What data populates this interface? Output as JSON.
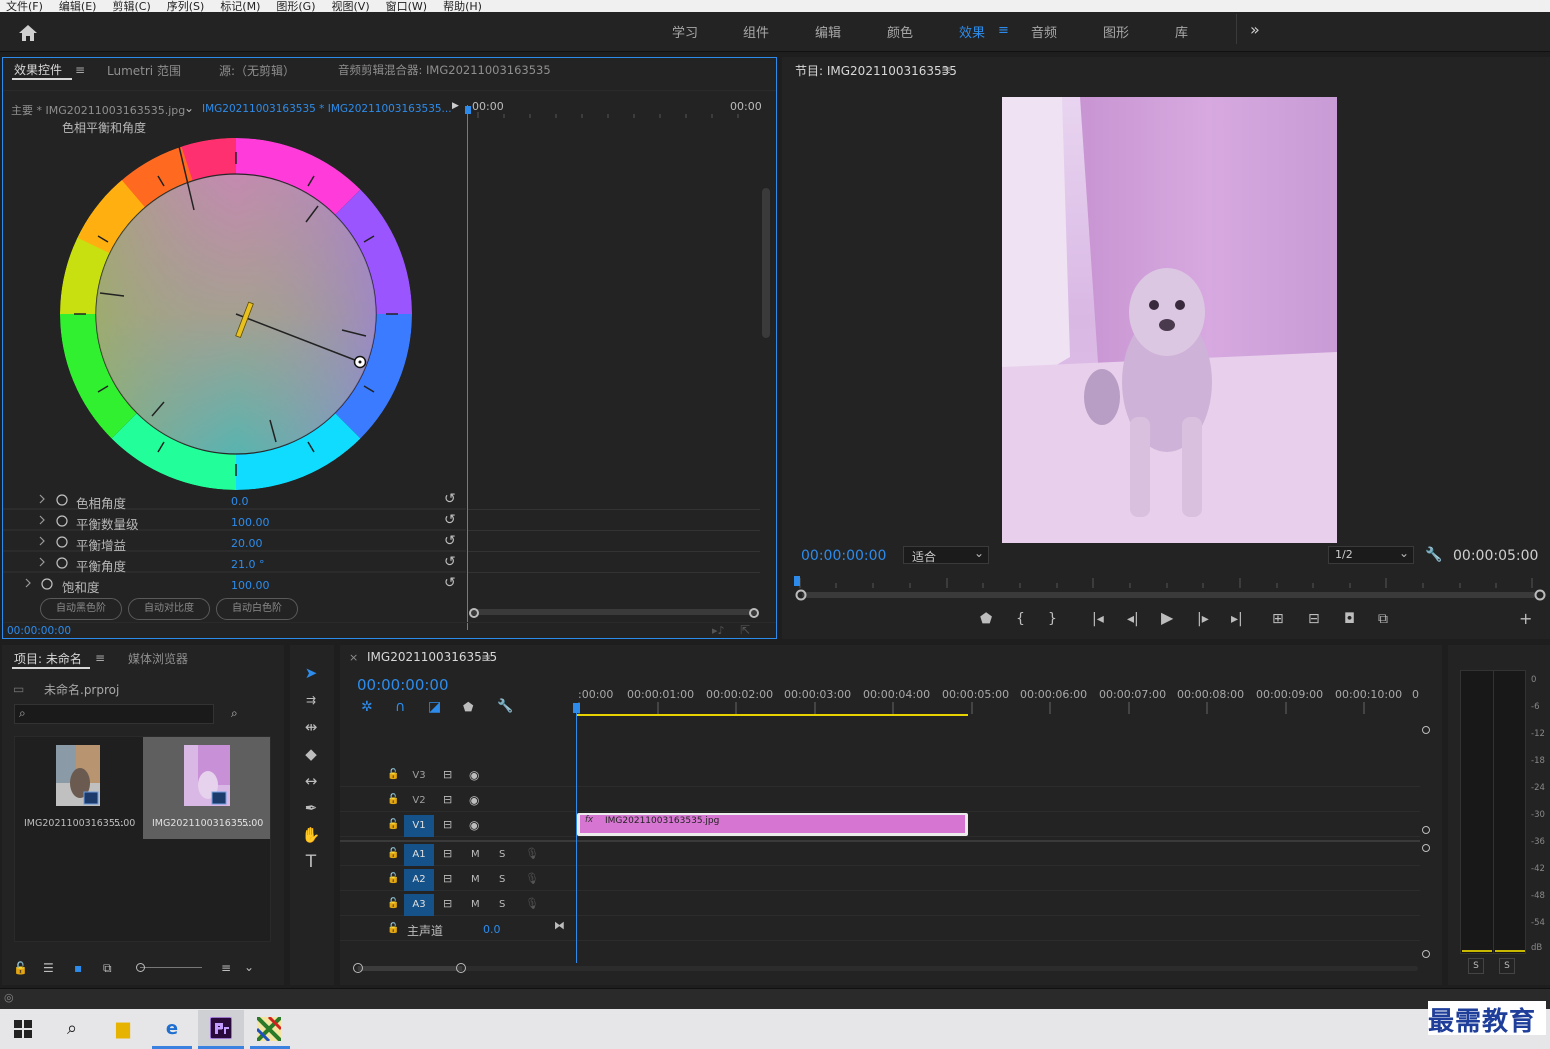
{
  "menu": [
    "文件(F)",
    "编辑(E)",
    "剪辑(C)",
    "序列(S)",
    "标记(M)",
    "图形(G)",
    "视图(V)",
    "窗口(W)",
    "帮助(H)"
  ],
  "workspaces": [
    "学习",
    "组件",
    "编辑",
    "颜色",
    "效果",
    "音频",
    "图形",
    "库"
  ],
  "workspace_active": "效果",
  "effect_panel": {
    "tabs": [
      "效果控件",
      "Lumetri 范围",
      "源:（无剪辑）",
      "音频剪辑混合器: IMG20211003163535"
    ],
    "master_clip": "主要 * IMG20211003163535.jpg",
    "sequence_clip": "IMG20211003163535 * IMG20211003163535...",
    "ruler_start": "00:00",
    "ruler_end": "00:00",
    "section_title": "色相平衡和角度",
    "properties": [
      {
        "label": "色相角度",
        "value": "0.0"
      },
      {
        "label": "平衡数量级",
        "value": "100.00"
      },
      {
        "label": "平衡增益",
        "value": "20.00"
      },
      {
        "label": "平衡角度",
        "value": "21.0 °"
      },
      {
        "label": "饱和度",
        "value": "100.00"
      }
    ],
    "buttons": [
      "自动黑色阶",
      "自动对比度",
      "自动白色阶"
    ],
    "timecode": "00:00:00:00"
  },
  "program_monitor": {
    "title": "节目: IMG20211003163535",
    "timecode": "00:00:00:00",
    "fit": "适合",
    "resolution": "1/2",
    "duration": "00:00:05:00"
  },
  "project": {
    "tabs": [
      "项目: 未命名",
      "媒体浏览器"
    ],
    "file": "未命名.prproj",
    "items": [
      {
        "name": "IMG202110031635...",
        "duration": "5:00"
      },
      {
        "name": "IMG202110031635...",
        "duration": "5:00"
      }
    ]
  },
  "timeline": {
    "tab": "IMG20211003163535",
    "timecode": "00:00:00:00",
    "ruler": [
      ":00:00",
      "00:00:01:00",
      "00:00:02:00",
      "00:00:03:00",
      "00:00:04:00",
      "00:00:05:00",
      "00:00:06:00",
      "00:00:07:00",
      "00:00:08:00",
      "00:00:09:00",
      "00:00:10:00",
      "0"
    ],
    "video_tracks": [
      "V3",
      "V2",
      "V1"
    ],
    "audio_tracks": [
      "A1",
      "A2",
      "A3"
    ],
    "master": "主声道",
    "master_value": "0.0",
    "clip": "IMG20211003163535.jpg",
    "fx_label": "fx",
    "m_label": "M",
    "s_label": "S"
  },
  "meter": {
    "scale": [
      "0",
      "-6",
      "-12",
      "-18",
      "-24",
      "-30",
      "-36",
      "-42",
      "-48",
      "-54",
      "dB"
    ],
    "solo": [
      "S",
      "S"
    ]
  },
  "watermark": "最需教育",
  "colors": {
    "accent": "#2d8ceb",
    "clip": "#d676d2",
    "panel": "#232323",
    "bg": "#1e1e1e"
  }
}
